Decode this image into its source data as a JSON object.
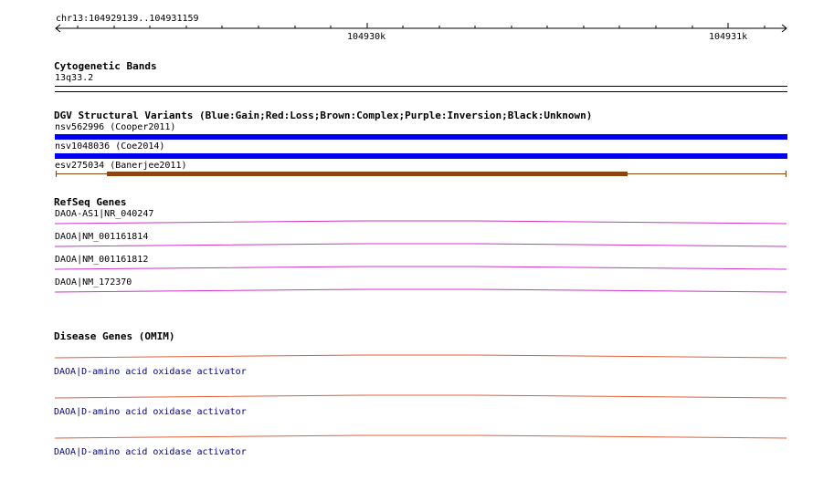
{
  "ruler": {
    "region": "chr13:104929139..104931159",
    "ticks": [
      "104930k",
      "104931k"
    ]
  },
  "cytoband": {
    "title": "Cytogenetic Bands",
    "band": "13q33.2"
  },
  "dgv": {
    "title": "DGV Structural Variants (Blue:Gain;Red:Loss;Brown:Complex;Purple:Inversion;Black:Unknown)",
    "items": [
      {
        "label": "nsv562996 (Cooper2011)",
        "color": "#0000ee"
      },
      {
        "label": "nsv1048036 (Coe2014)",
        "color": "#0000ee"
      },
      {
        "label": "esv275034 (Banerjee2011)",
        "color": "#8b4513"
      }
    ]
  },
  "refseq": {
    "title": "RefSeq Genes",
    "color": "#cc33cc",
    "items": [
      {
        "label": "DAOA-AS1|NR_040247"
      },
      {
        "label": "DAOA|NM_001161814"
      },
      {
        "label": "DAOA|NM_001161812"
      },
      {
        "label": "DAOA|NM_172370"
      }
    ]
  },
  "omim": {
    "title": "Disease Genes (OMIM)",
    "color": "#e0603a",
    "items": [
      {
        "label": "DAOA|D-amino acid oxidase activator"
      },
      {
        "label": "DAOA|D-amino acid oxidase activator"
      },
      {
        "label": "DAOA|D-amino acid oxidase activator"
      }
    ]
  }
}
